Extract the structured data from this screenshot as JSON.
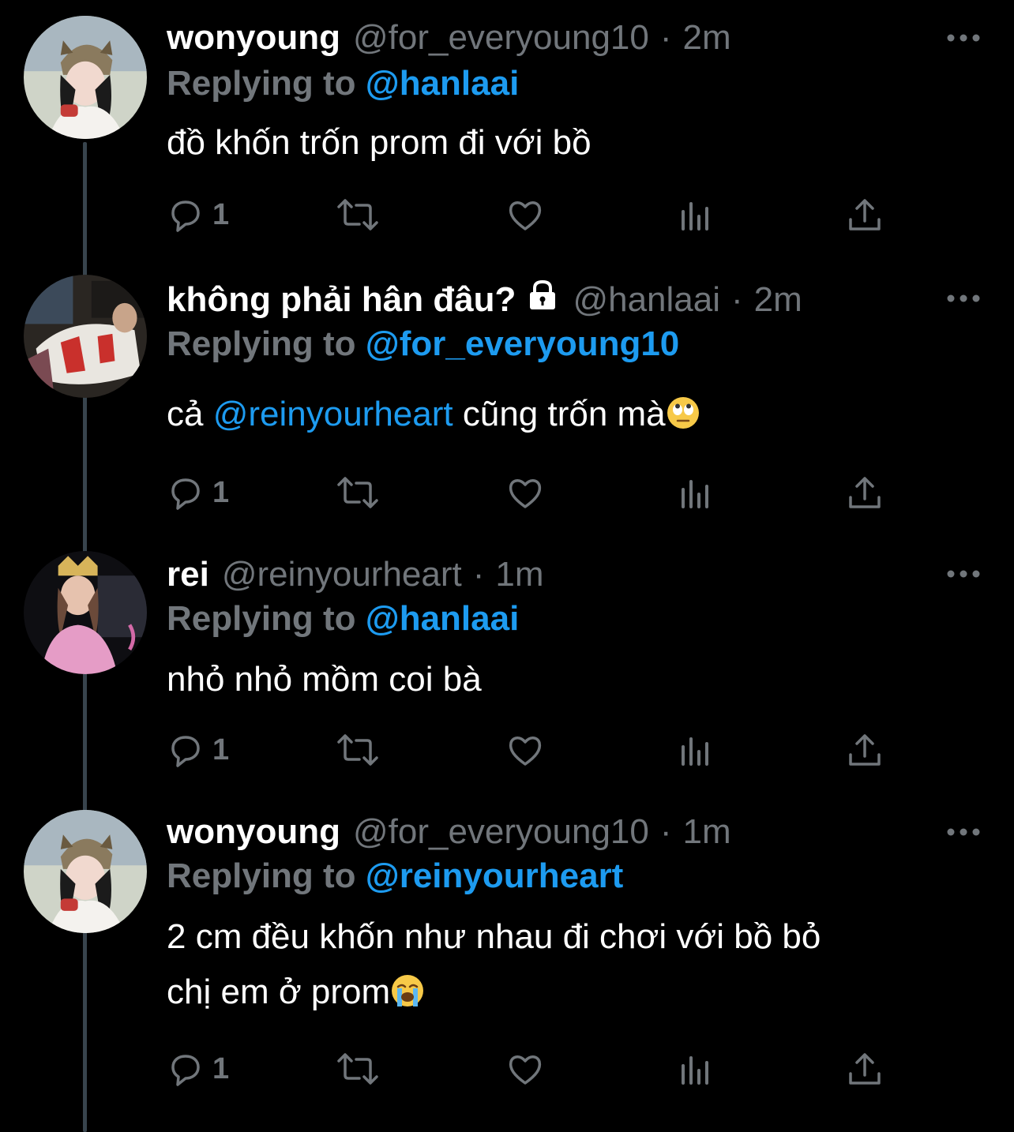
{
  "tweets": [
    {
      "name": "wonyoung",
      "handle": "@for_everyoung10",
      "separator": "·",
      "time": "2m",
      "replying_label": "Replying to",
      "replying_to": "@hanlaai",
      "text_parts": [
        "đồ khốn trốn prom đi với bồ"
      ],
      "reply_count": "1",
      "avatar": "girl-with-cat-hat-avatar"
    },
    {
      "name": "không phải hân đâu?",
      "handle": "@hanlaai",
      "separator": "·",
      "time": "2m",
      "replying_label": "Replying to",
      "replying_to": "@for_everyoung10",
      "text_before": "cả ",
      "text_mention": "@reinyourheart",
      "text_after": " cũng trốn mà",
      "emoji": "face-with-rolling-eyes-emoji",
      "reply_count": "1",
      "avatar": "jersey-photo-avatar"
    },
    {
      "name": "rei",
      "handle": "@reinyourheart",
      "separator": "·",
      "time": "1m",
      "replying_label": "Replying to",
      "replying_to": "@hanlaai",
      "text_parts": [
        "nhỏ nhỏ mồm coi bà"
      ],
      "reply_count": "1",
      "avatar": "girl-pink-shirt-avatar"
    },
    {
      "name": "wonyoung",
      "handle": "@for_everyoung10",
      "separator": "·",
      "time": "1m",
      "replying_label": "Replying to",
      "replying_to": "@reinyourheart",
      "text_line1": "2 cm đều khốn như nhau đi chơi với bồ bỏ",
      "text_line2": "chị em ở prom",
      "emoji": "loudly-crying-face-emoji",
      "reply_count": "1",
      "avatar": "girl-with-cat-hat-avatar"
    }
  ],
  "colors": {
    "background": "#000000",
    "text": "#ffffff",
    "secondary": "#71767b",
    "accent": "#1d9bf0",
    "thread_line": "#38444d"
  },
  "icons": [
    "reply-icon",
    "retweet-icon",
    "like-icon",
    "analytics-icon",
    "share-icon",
    "more-icon",
    "lock-icon"
  ]
}
